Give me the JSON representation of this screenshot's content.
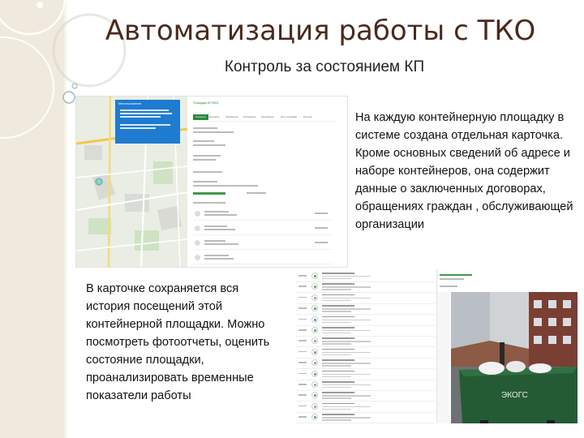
{
  "slide": {
    "title": "Автоматизация работы с ТКО",
    "subtitle": "Контроль за состоянием КП",
    "text_right": "На каждую контейнерную площадку в системе создана отдельная карточка.  Кроме основных  сведений об адресе и наборе контейнеров, она содержит данные о заключенных договорах, обращениях граждан , обслуживающей организации",
    "text_left": "В карточке сохраняется вся история посещений этой контейнерной площадки. Можно посмотреть фотоотчеты, оценить состояние площадки, проанализировать временные показатели работы"
  },
  "screenshot_card": {
    "popup_header": "Местоположение",
    "panel_title": "Площадка КП 9903",
    "tabs": [
      "Основное",
      "Договоры",
      "Обращения",
      "Посещения",
      "Контейнеры",
      "Фото площадки",
      "История"
    ]
  },
  "photo": {
    "container_label": "ЭКОГС"
  },
  "colors": {
    "title": "#4a2a1e",
    "accent_green": "#2a8a3a",
    "popup_blue": "#1f7bd0",
    "container_green": "#2e6a3c"
  }
}
